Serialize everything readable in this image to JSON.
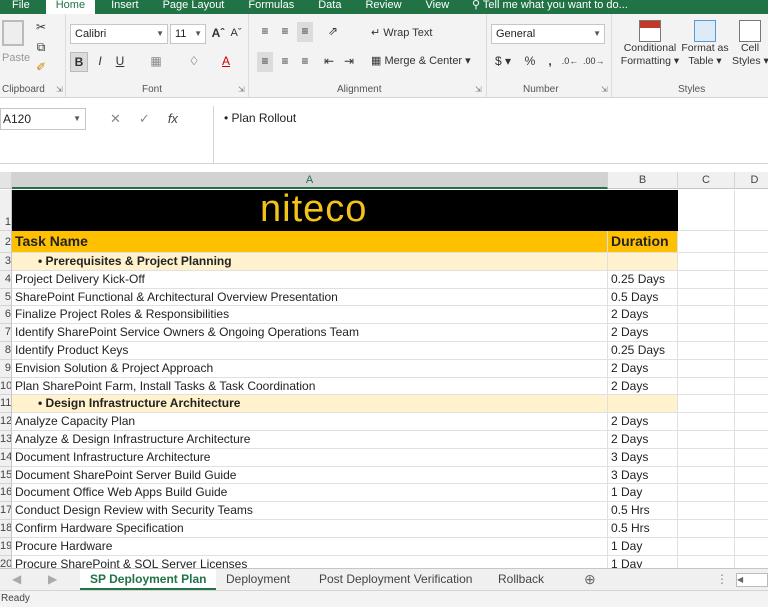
{
  "ribbon_tabs": [
    "File",
    "Home",
    "Insert",
    "Page Layout",
    "Formulas",
    "Data",
    "Review",
    "View"
  ],
  "tell_me": "Tell me what you want to do...",
  "clipboard": {
    "paste": "Paste",
    "label": "Clipboard"
  },
  "font": {
    "name": "Calibri",
    "size": "11",
    "label": "Font",
    "bold": "B",
    "italic": "I",
    "underline": "U"
  },
  "alignment": {
    "wrap": "Wrap Text",
    "merge": "Merge & Center",
    "label": "Alignment"
  },
  "number": {
    "format": "General",
    "label": "Number",
    "currency": "$",
    "percent": "%",
    "comma": ","
  },
  "styles": {
    "conditional": "Conditional",
    "formatting": "Formatting",
    "format_as": "Format as",
    "table": "Table",
    "cell": "Cell",
    "cell_styles": "Styles",
    "label": "Styles"
  },
  "name_box": "A120",
  "formula": "• Plan Rollout",
  "columns": [
    "A",
    "B",
    "C",
    "D"
  ],
  "logo": "niteco",
  "header": {
    "task": "Task Name",
    "duration": "Duration"
  },
  "rows": [
    {
      "num": "3",
      "task": "• Prerequisites & Project Planning",
      "dur": "",
      "section": true
    },
    {
      "num": "4",
      "task": "Project Delivery Kick-Off",
      "dur": "0.25 Days"
    },
    {
      "num": "5",
      "task": "SharePoint Functional & Architectural Overview Presentation",
      "dur": "0.5 Days"
    },
    {
      "num": "6",
      "task": "Finalize Project Roles & Responsibilities",
      "dur": "2 Days"
    },
    {
      "num": "7",
      "task": "Identify SharePoint Service Owners & Ongoing Operations Team",
      "dur": "2 Days"
    },
    {
      "num": "8",
      "task": "Identify Product Keys",
      "dur": "0.25 Days"
    },
    {
      "num": "9",
      "task": "Envision Solution & Project Approach",
      "dur": "2 Days"
    },
    {
      "num": "10",
      "task": "Plan SharePoint Farm, Install Tasks & Task Coordination",
      "dur": "2 Days"
    },
    {
      "num": "11",
      "task": "• Design Infrastructure Architecture",
      "dur": "",
      "section": true
    },
    {
      "num": "12",
      "task": "Analyze Capacity Plan",
      "dur": "2 Days"
    },
    {
      "num": "13",
      "task": "Analyze & Design Infrastructure Architecture",
      "dur": "2 Days"
    },
    {
      "num": "14",
      "task": "Document Infrastructure Architecture",
      "dur": "3 Days"
    },
    {
      "num": "15",
      "task": "Document SharePoint Server Build Guide",
      "dur": "3 Days"
    },
    {
      "num": "16",
      "task": "Document Office Web Apps Build Guide",
      "dur": "1 Day"
    },
    {
      "num": "17",
      "task": "Conduct Design Review with Security Teams",
      "dur": "0.5 Hrs"
    },
    {
      "num": "18",
      "task": "Confirm Hardware Specification",
      "dur": "0.5 Hrs"
    },
    {
      "num": "19",
      "task": "Procure Hardware",
      "dur": "1 Day"
    },
    {
      "num": "20",
      "task": "Procure SharePoint & SQL Server Licenses",
      "dur": "1 Day"
    }
  ],
  "sheet_tabs": [
    "SP Deployment Plan",
    "Deployment",
    "Post Deployment Verification",
    "Rollback"
  ],
  "status": "Ready"
}
